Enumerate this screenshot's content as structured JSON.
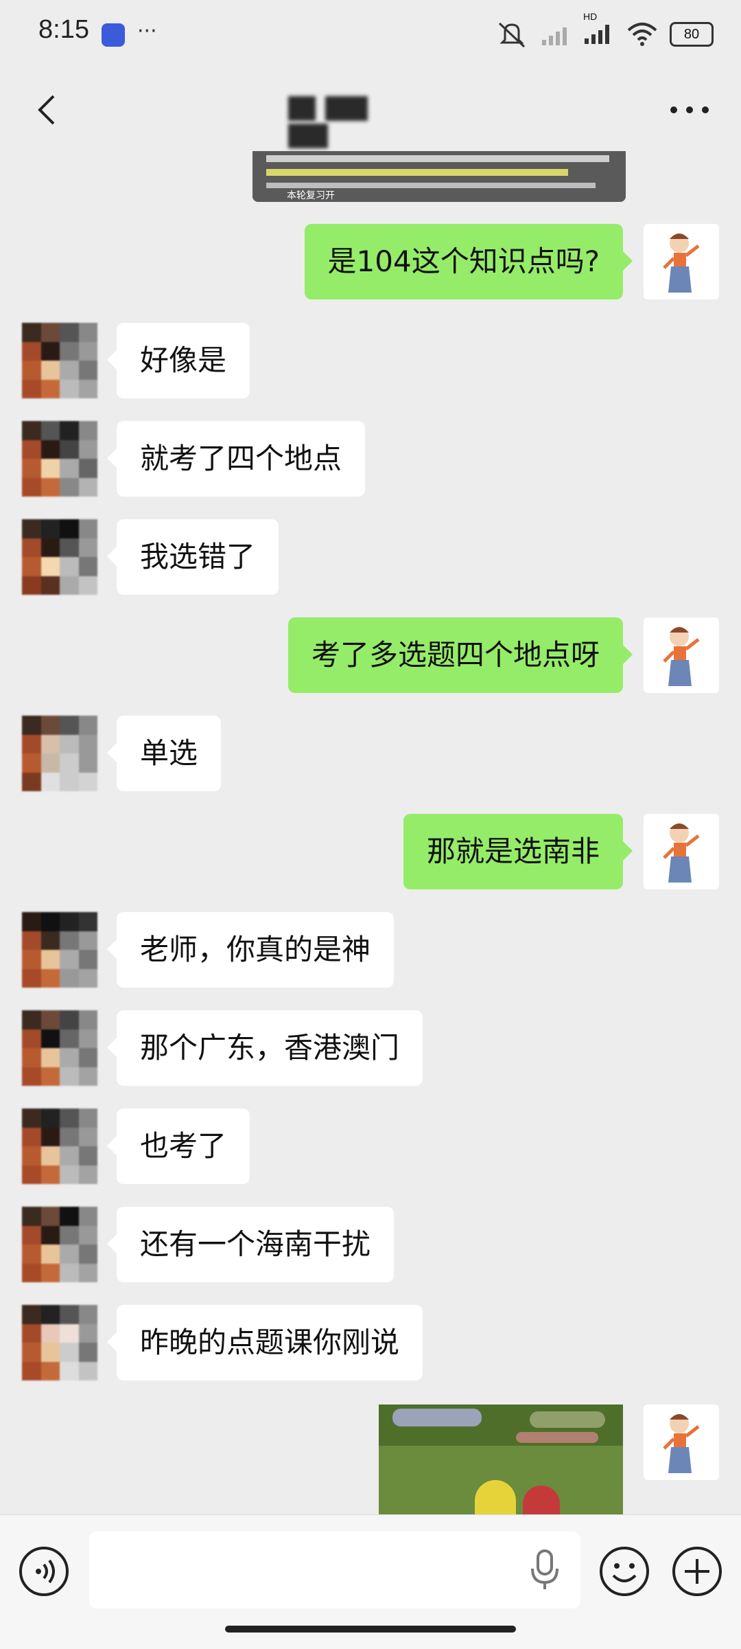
{
  "status_bar": {
    "time": "8:15",
    "more": "···",
    "hd": "HD",
    "battery": "80"
  },
  "nav": {
    "back_icon": "chevron-left-icon",
    "more_icon": "more-dots-icon"
  },
  "messages": [
    {
      "side": "out",
      "text": "是104这个知识点吗?"
    },
    {
      "side": "in",
      "text": "好像是"
    },
    {
      "side": "in",
      "text": "就考了四个地点"
    },
    {
      "side": "in",
      "text": "我选错了"
    },
    {
      "side": "out",
      "text": "考了多选题四个地点呀"
    },
    {
      "side": "in",
      "text": "单选"
    },
    {
      "side": "out",
      "text": "那就是选南非"
    },
    {
      "side": "in",
      "text": "老师，你真的是神"
    },
    {
      "side": "in",
      "text": "那个广东，香港澳门"
    },
    {
      "side": "in",
      "text": "也考了"
    },
    {
      "side": "in",
      "text": "还有一个海南干扰"
    },
    {
      "side": "in",
      "text": "昨晚的点题课你刚说"
    }
  ],
  "image_top_caption": "本轮复习开",
  "input_bar": {
    "placeholder": ""
  },
  "colors": {
    "background": "#ededed",
    "bubble_out": "#95ec69",
    "bubble_in": "#ffffff"
  }
}
